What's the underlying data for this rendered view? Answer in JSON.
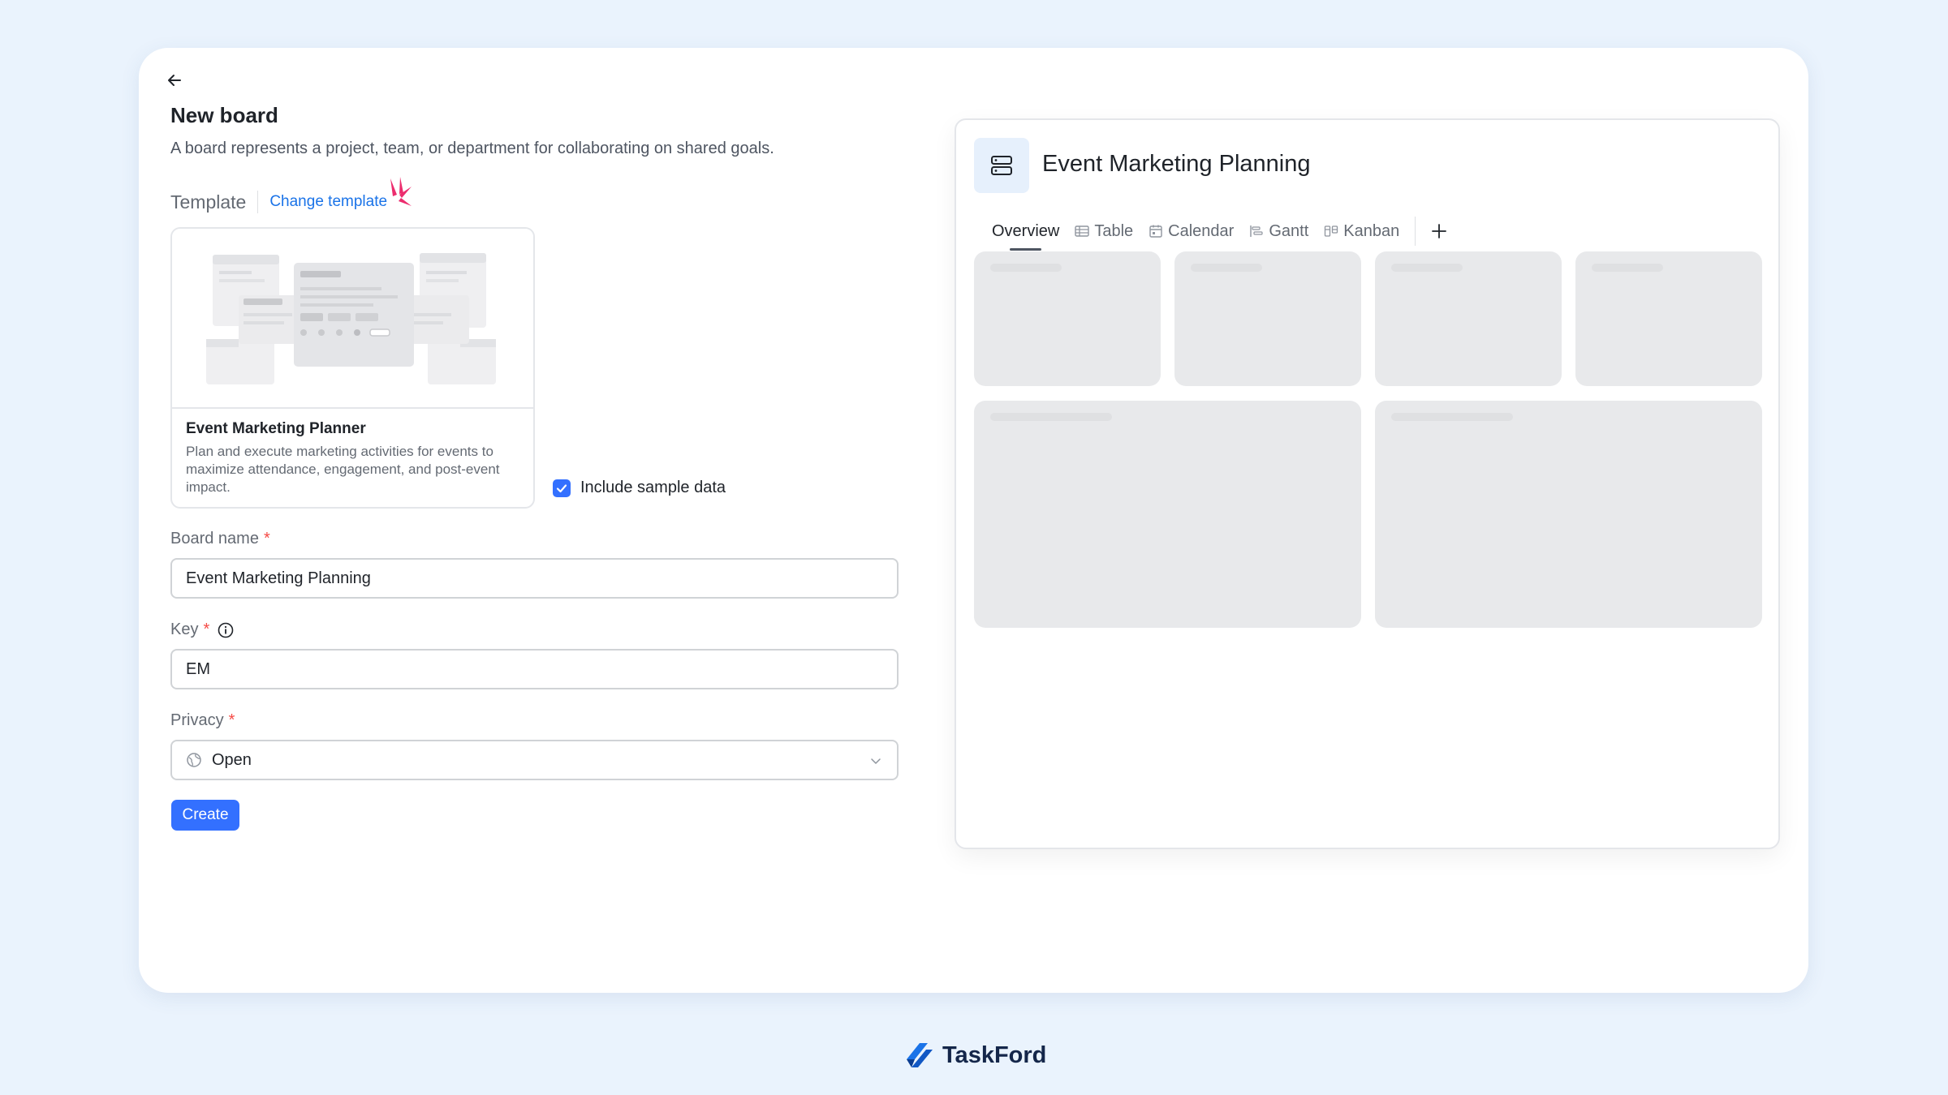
{
  "page": {
    "title": "New board",
    "description": "A board represents a project, team, or department for collaborating on shared goals."
  },
  "template": {
    "label": "Template",
    "change_link": "Change template",
    "card": {
      "name": "Event Marketing Planner",
      "description": "Plan and execute marketing activities for events to maximize attendance, engagement, and post-event impact."
    },
    "include_sample": {
      "label": "Include sample data",
      "checked": true
    }
  },
  "form": {
    "board_name": {
      "label": "Board name",
      "value": "Event Marketing Planning"
    },
    "key": {
      "label": "Key",
      "value": "EM"
    },
    "privacy": {
      "label": "Privacy",
      "value": "Open"
    },
    "required_mark": "*",
    "create_label": "Create"
  },
  "preview": {
    "board_title": "Event Marketing Planning",
    "tabs": [
      {
        "label": "Overview",
        "icon": "none",
        "active": true
      },
      {
        "label": "Table",
        "icon": "table-icon"
      },
      {
        "label": "Calendar",
        "icon": "calendar-icon"
      },
      {
        "label": "Gantt",
        "icon": "gantt-icon"
      },
      {
        "label": "Kanban",
        "icon": "kanban-icon"
      }
    ]
  },
  "brand": {
    "name": "TaskFord"
  },
  "colors": {
    "accent": "#3370ff",
    "link": "#1a73e8",
    "required": "#f54a45",
    "background": "#eaf3fd"
  }
}
